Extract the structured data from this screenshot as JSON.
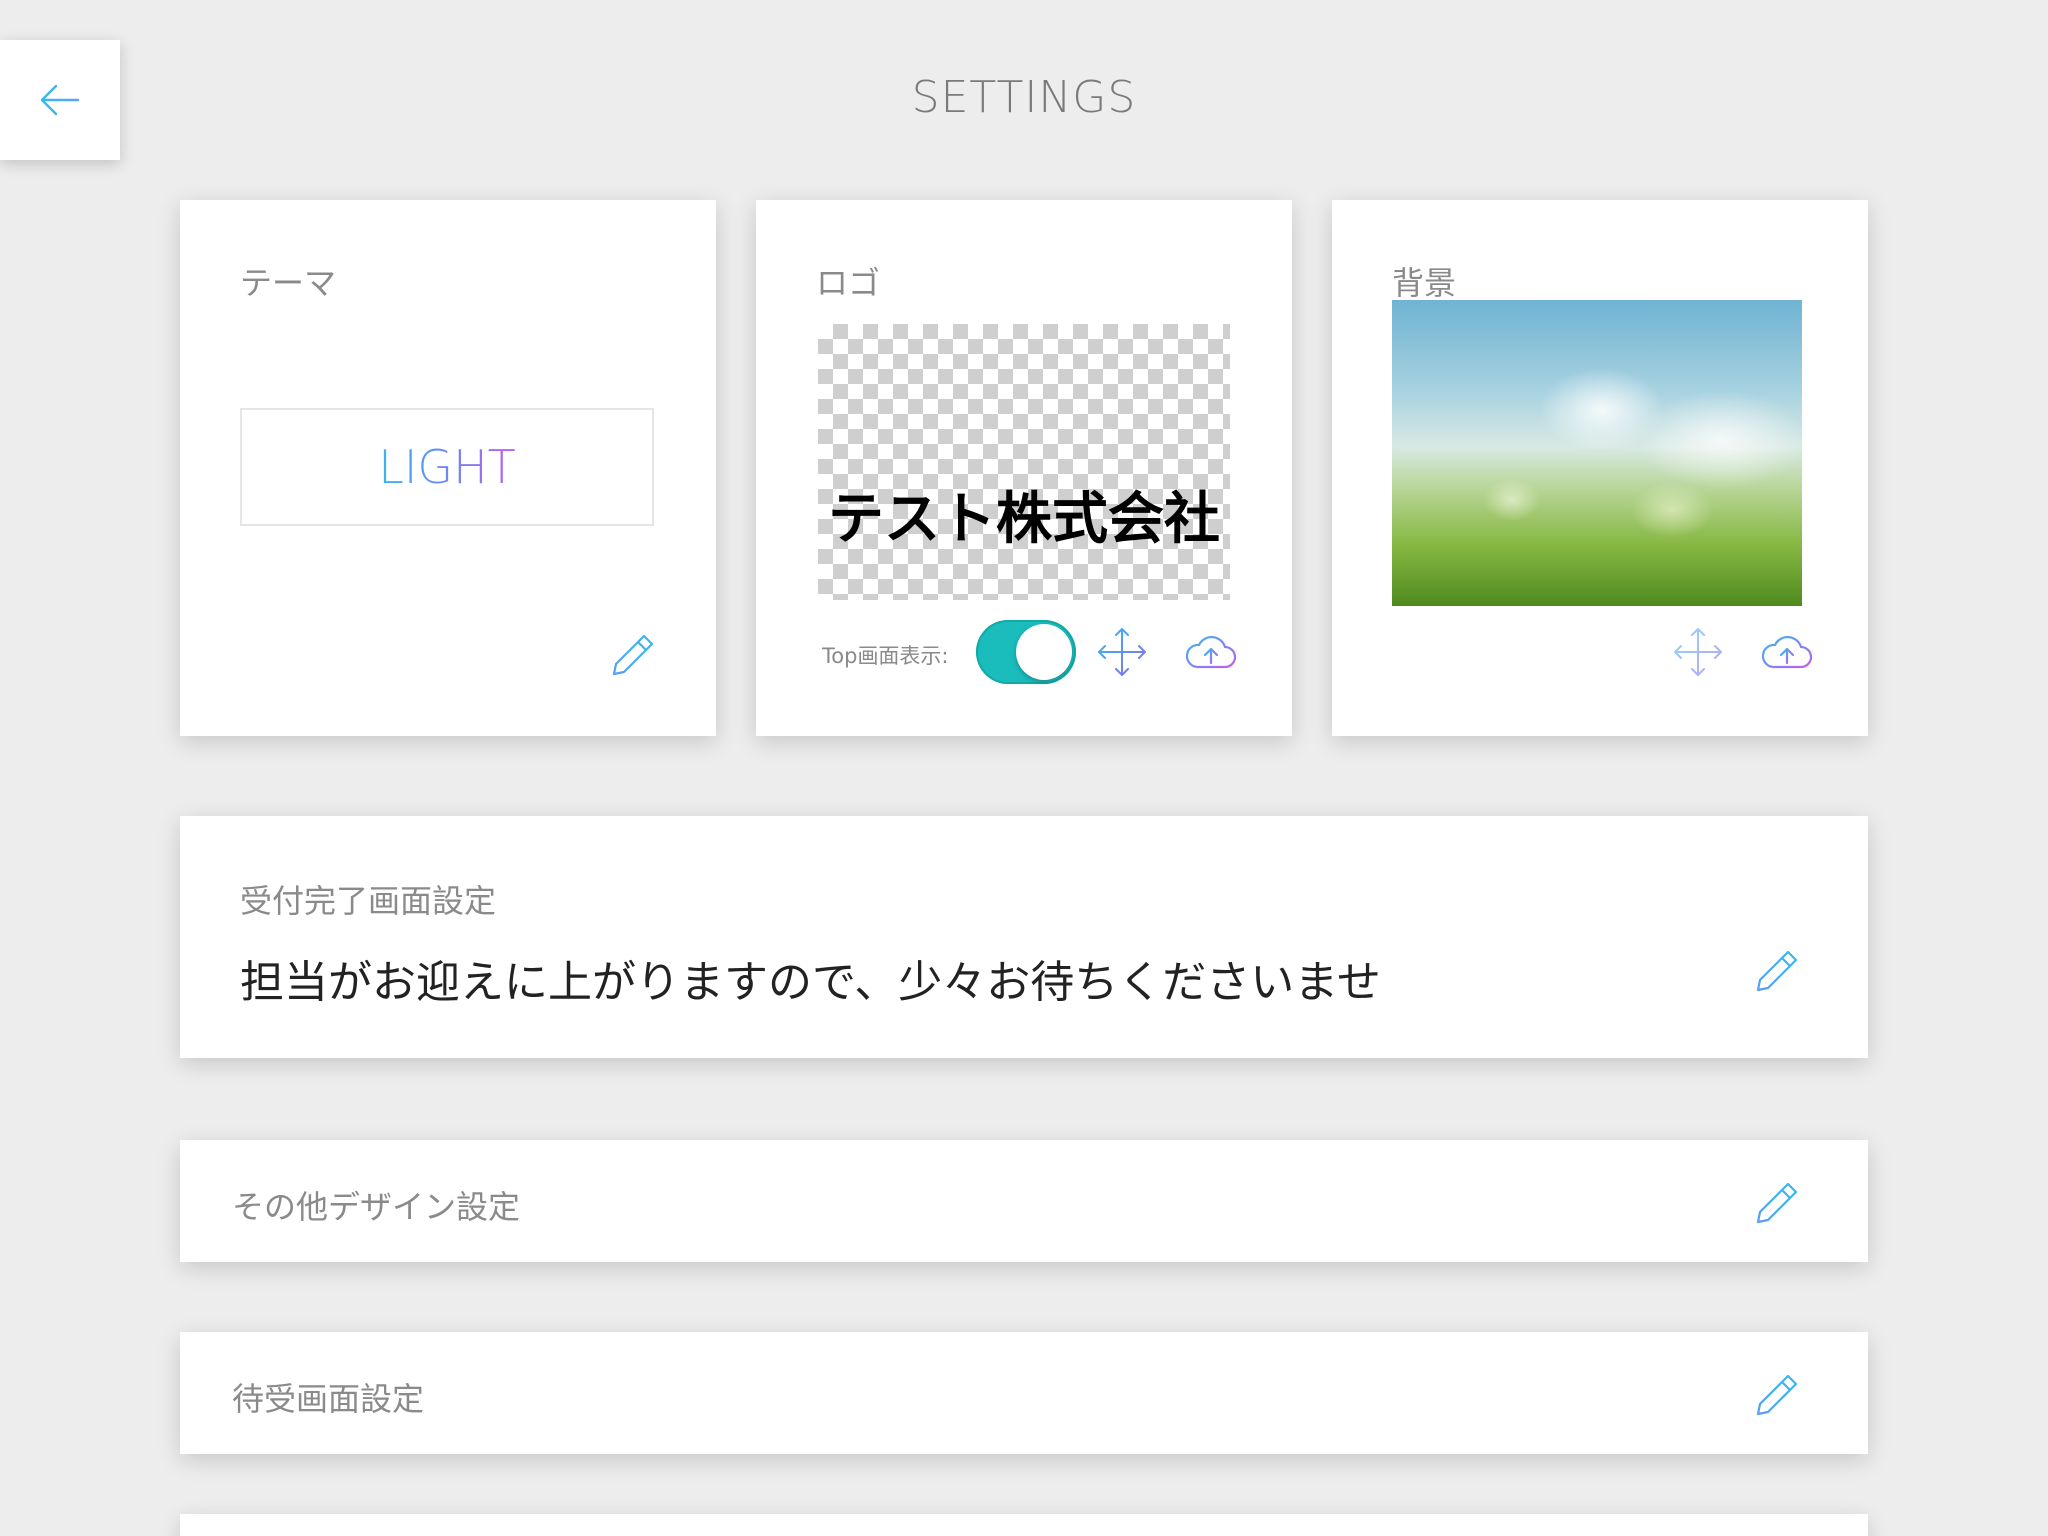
{
  "header": {
    "title": "SETTINGS"
  },
  "theme_card": {
    "label": "テーマ",
    "value": "LIGHT"
  },
  "logo_card": {
    "label": "ロゴ",
    "logo_text": "テスト株式会社",
    "top_display_label": "Top画面表示:",
    "top_display_enabled": true
  },
  "background_card": {
    "label": "背景"
  },
  "completion_card": {
    "label": "受付完了画面設定",
    "message": "担当がお迎えに上がりますので、少々お待ちくださいませ"
  },
  "other_design_card": {
    "label": "その他デザイン設定"
  },
  "standby_card": {
    "label": "待受画面設定"
  },
  "colors": {
    "background": "#ededed",
    "toggle_on": "#1bbcbc",
    "icon_gradient_start": "#34b9f0",
    "icon_gradient_end": "#c05cf0"
  },
  "icons": [
    "back-arrow-icon",
    "pencil-icon",
    "move-arrows-icon",
    "cloud-upload-icon"
  ]
}
